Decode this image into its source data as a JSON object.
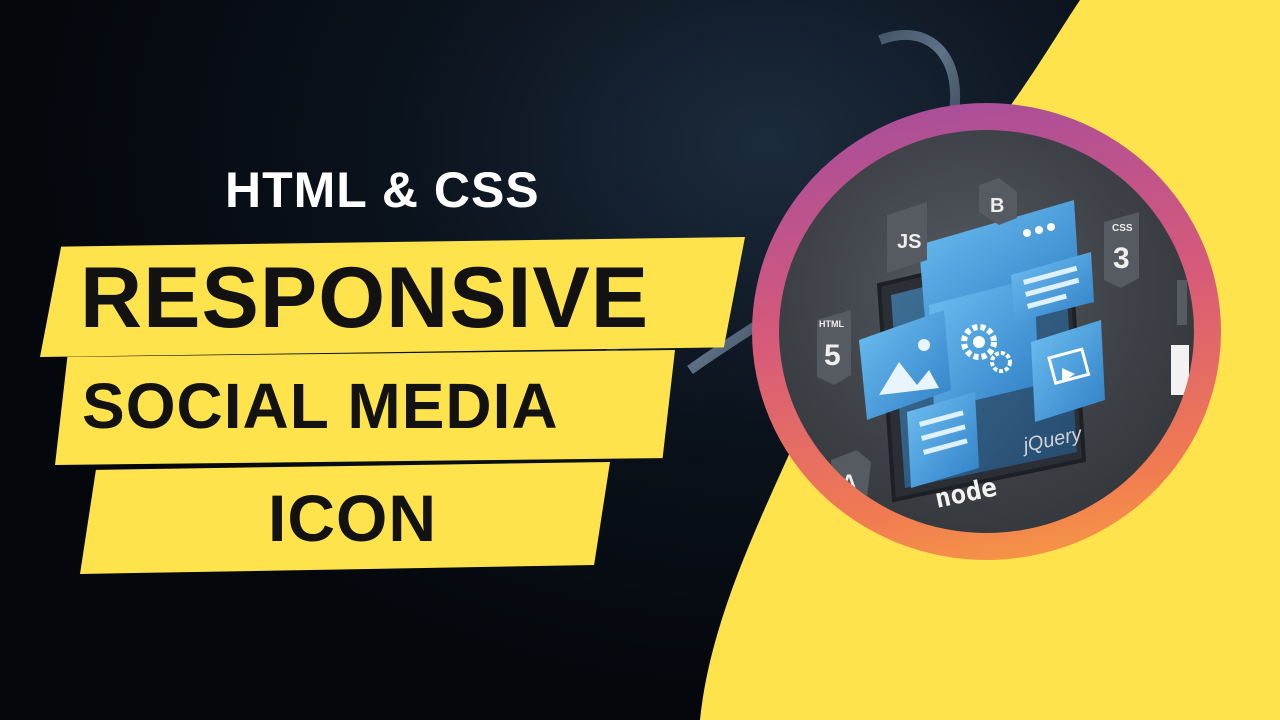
{
  "heading": "HTML & CSS",
  "banner_lines": [
    "RESPONSIVE",
    "SOCIAL MEDIA",
    "ICON"
  ],
  "illustration": {
    "badges": [
      "JS",
      "B",
      "CSS",
      "3",
      "HTML",
      "5",
      "A"
    ],
    "logos": [
      "node",
      "jQuery"
    ],
    "icons": [
      "image-icon",
      "gear-icon",
      "video-icon",
      "window-icon"
    ]
  },
  "colors": {
    "background": "#05080d",
    "accent_yellow": "#ffe34d",
    "banner_text": "#121212",
    "heading_text": "#ffffff",
    "ring_top": "#a34c9e",
    "ring_bottom": "#f8a040",
    "panel_blue": "#3d9be0"
  }
}
